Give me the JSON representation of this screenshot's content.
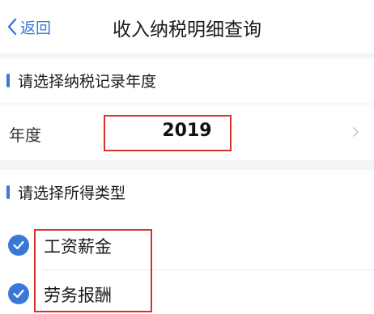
{
  "nav": {
    "back_label": "返回",
    "title": "收入纳税明细查询"
  },
  "year_section": {
    "title": "请选择纳税记录年度",
    "row_label": "年度",
    "selected_year": "2019"
  },
  "income_section": {
    "title": "请选择所得类型",
    "options": [
      {
        "label": "工资薪金",
        "checked": true
      },
      {
        "label": "劳务报酬",
        "checked": true
      }
    ]
  },
  "colors": {
    "accent": "#3a78d8",
    "highlight": "#d9302f",
    "background_gap": "#f3f4f6"
  },
  "icons": {
    "back": "chevron-left-icon",
    "row_arrow": "chevron-right-icon",
    "check": "check-circle-icon"
  }
}
